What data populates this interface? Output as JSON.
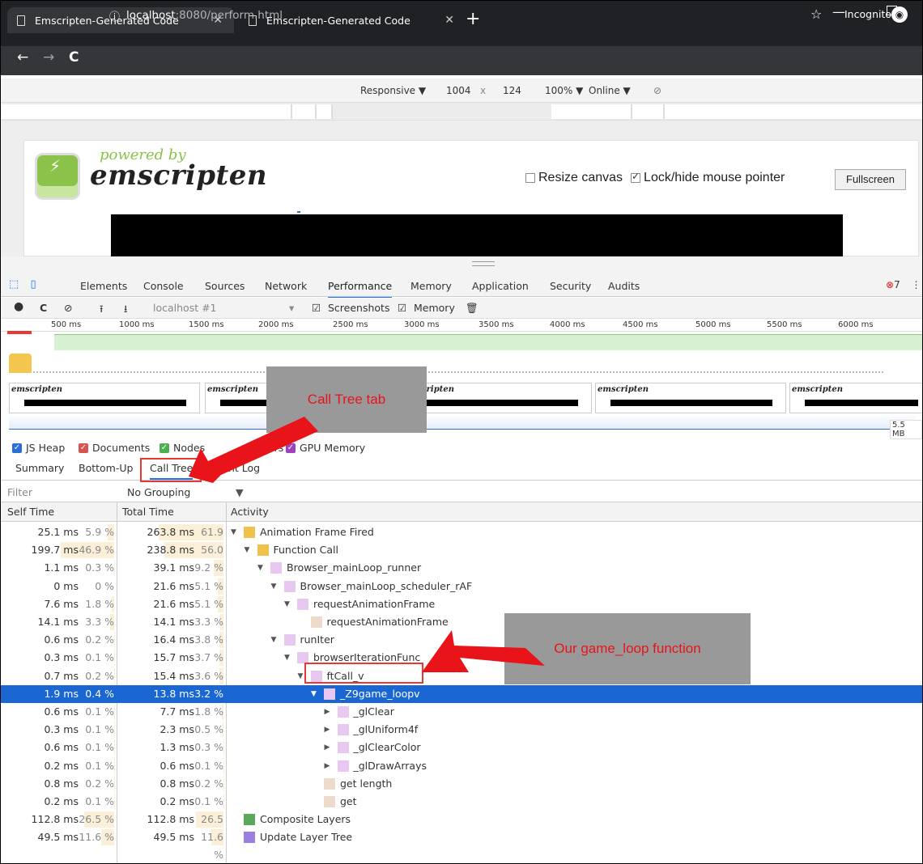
{
  "browser": {
    "tabs": [
      {
        "title": "Emscripten-Generated Code",
        "close": "✕"
      },
      {
        "title": "Emscripten-Generated Code",
        "close": "✕"
      }
    ],
    "new_tab": "+",
    "url_host": "localhost",
    "url_path": ":8080/perform.html",
    "star": "☆",
    "incognito": "Incognito"
  },
  "device_toolbar": {
    "mode": "Responsive ▼",
    "width": "1004",
    "times": "x",
    "height": "124",
    "zoom": "100% ▼",
    "network": "Online ▼"
  },
  "page": {
    "powered_by": "powered by",
    "emscripten": "emscripten",
    "resize_canvas": "Resize canvas",
    "lock_hide": "Lock/hide mouse pointer",
    "fullscreen": "Fullscreen"
  },
  "devtools": {
    "tabs": [
      "Elements",
      "Console",
      "Sources",
      "Network",
      "Performance",
      "Memory",
      "Application",
      "Security",
      "Audits"
    ],
    "error_count": "7",
    "perf_toolbar": {
      "profile": "localhost #1",
      "screenshots": "Screenshots",
      "memory": "Memory"
    },
    "overview_ticks": [
      "500 ms",
      "1000 ms",
      "1500 ms",
      "2000 ms",
      "2500 ms",
      "3000 ms",
      "3500 ms",
      "4000 ms",
      "4500 ms",
      "5000 ms",
      "5500 ms",
      "6000 ms"
    ],
    "mem_label": "5.5 MB",
    "legend": [
      "JS Heap",
      "Documents",
      "Nodes",
      "ners",
      "GPU Memory"
    ],
    "subtabs": [
      "Summary",
      "Bottom-Up",
      "Call Tree",
      "Event Log"
    ],
    "filter_placeholder": "Filter",
    "grouping": "No Grouping",
    "grouping_arrow": "▼",
    "headers": {
      "self": "Self Time",
      "total": "Total Time",
      "activity": "Activity"
    },
    "rows": [
      {
        "self": "25.1 ms",
        "selfp": "5.9 %",
        "total": "263.8 ms",
        "totalp": "61.9 %",
        "label": "Animation Frame Fired",
        "tri": "▼",
        "color": "#f0c14b"
      },
      {
        "self": "199.7 ms",
        "selfp": "46.9 %",
        "total": "238.8 ms",
        "totalp": "56.0 %",
        "label": "Function Call",
        "tri": "▼",
        "color": "#f0c14b"
      },
      {
        "self": "1.1 ms",
        "selfp": "0.3 %",
        "total": "39.1 ms",
        "totalp": "9.2 %",
        "label": "Browser_mainLoop_runner",
        "tri": "▼",
        "color": "#e8c8f0"
      },
      {
        "self": "0 ms",
        "selfp": "0 %",
        "total": "21.6 ms",
        "totalp": "5.1 %",
        "label": "Browser_mainLoop_scheduler_rAF",
        "tri": "▼",
        "color": "#e8c8f0"
      },
      {
        "self": "7.6 ms",
        "selfp": "1.8 %",
        "total": "21.6 ms",
        "totalp": "5.1 %",
        "label": "requestAnimationFrame",
        "tri": "▼",
        "color": "#e8c8f0"
      },
      {
        "self": "14.1 ms",
        "selfp": "3.3 %",
        "total": "14.1 ms",
        "totalp": "3.3 %",
        "label": "requestAnimationFrame",
        "tri": "",
        "color": "#eedccb"
      },
      {
        "self": "0.6 ms",
        "selfp": "0.2 %",
        "total": "16.4 ms",
        "totalp": "3.8 %",
        "label": "runIter",
        "tri": "▼",
        "color": "#e8c8f0"
      },
      {
        "self": "0.3 ms",
        "selfp": "0.1 %",
        "total": "15.7 ms",
        "totalp": "3.7 %",
        "label": "browserIterationFunc",
        "tri": "▼",
        "color": "#e8c8f0"
      },
      {
        "self": "0.7 ms",
        "selfp": "0.2 %",
        "total": "15.4 ms",
        "totalp": "3.6 %",
        "label": "ftCall_v",
        "tri": "▼",
        "color": "#e8c8f0"
      },
      {
        "self": "1.9 ms",
        "selfp": "0.4 %",
        "total": "13.8 ms",
        "totalp": "3.2 %",
        "label": "_Z9game_loopv",
        "tri": "▼",
        "color": "#e8c8f0"
      },
      {
        "self": "0.6 ms",
        "selfp": "0.1 %",
        "total": "7.7 ms",
        "totalp": "1.8 %",
        "label": "_glClear",
        "tri": "▶",
        "color": "#e8c8f0"
      },
      {
        "self": "0.3 ms",
        "selfp": "0.1 %",
        "total": "2.3 ms",
        "totalp": "0.5 %",
        "label": "_glUniform4f",
        "tri": "▶",
        "color": "#e8c8f0"
      },
      {
        "self": "0.6 ms",
        "selfp": "0.1 %",
        "total": "1.3 ms",
        "totalp": "0.3 %",
        "label": "_glClearColor",
        "tri": "▶",
        "color": "#e8c8f0"
      },
      {
        "self": "0.2 ms",
        "selfp": "0.1 %",
        "total": "0.6 ms",
        "totalp": "0.1 %",
        "label": "_glDrawArrays",
        "tri": "▶",
        "color": "#e8c8f0"
      },
      {
        "self": "0.8 ms",
        "selfp": "0.2 %",
        "total": "0.8 ms",
        "totalp": "0.2 %",
        "label": "get length",
        "tri": "",
        "color": "#eedccb"
      },
      {
        "self": "0.2 ms",
        "selfp": "0.1 %",
        "total": "0.2 ms",
        "totalp": "0.1 %",
        "label": "get",
        "tri": "",
        "color": "#eedccb"
      },
      {
        "self": "112.8 ms",
        "selfp": "26.5 %",
        "total": "112.8 ms",
        "totalp": "26.5 %",
        "label": "Composite Layers",
        "tri": "",
        "color": "#5aa85a"
      },
      {
        "self": "49.5 ms",
        "selfp": "11.6 %",
        "total": "49.5 ms",
        "totalp": "11.6 %",
        "label": "Update Layer Tree",
        "tri": "",
        "color": "#9b7fe0"
      }
    ],
    "selected_row": 9
  },
  "annotations": {
    "call_tree_tab": "Call Tree tab",
    "game_loop": "Our game_loop function"
  }
}
